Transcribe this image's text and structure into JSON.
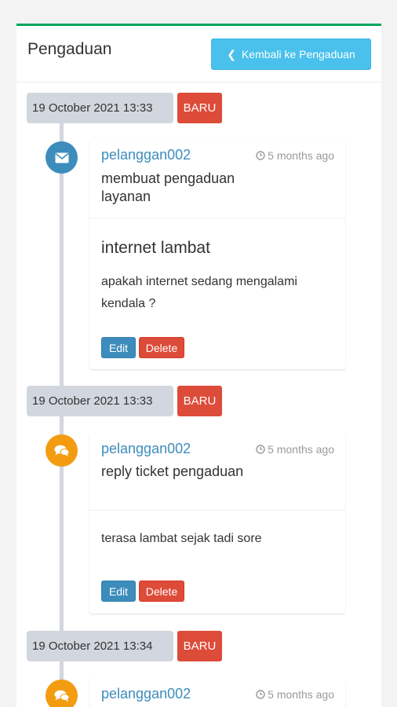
{
  "header": {
    "title": "Pengaduan",
    "back_button_label": "Kembali ke Pengaduan"
  },
  "timeline": [
    {
      "date": "19 October 2021 13:33",
      "badge": "BARU",
      "icon": "envelope-icon",
      "user": "pelanggan002",
      "time_ago": "5 months ago",
      "action": "membuat pengaduan layanan",
      "subject": "internet lambat",
      "text": "apakah internet sedang mengalami kendala ?",
      "edit_label": "Edit",
      "delete_label": "Delete"
    },
    {
      "date": "19 October 2021 13:33",
      "badge": "BARU",
      "icon": "comments-icon",
      "user": "pelanggan002",
      "time_ago": "5 months ago",
      "action": "reply ticket pengaduan",
      "text": "terasa lambat sejak tadi sore",
      "edit_label": "Edit",
      "delete_label": "Delete"
    },
    {
      "date": "19 October 2021 13:34",
      "badge": "BARU",
      "icon": "comments-icon",
      "user": "pelanggan002",
      "time_ago": "5 months ago"
    }
  ],
  "colors": {
    "box_top_border": "#00a65a",
    "back_button": "#49c1ec",
    "badge_red": "#dd4b39",
    "primary_blue": "#3c8dbc",
    "warning_orange": "#f39c12",
    "timeline_gray": "#d2d6de"
  }
}
